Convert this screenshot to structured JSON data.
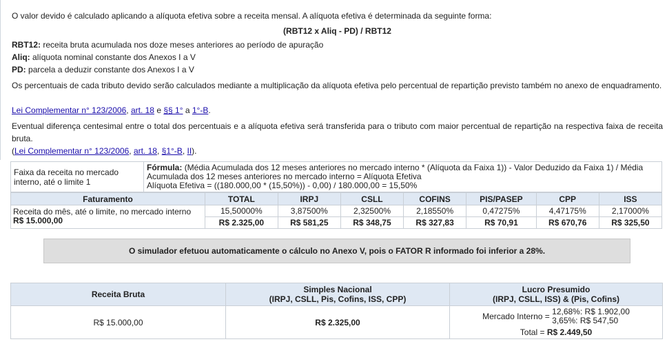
{
  "intro": "O valor devido é calculado aplicando a alíquota efetiva sobre a receita mensal. A alíquota efetiva é determinada da seguinte forma:",
  "formula": "(RBT12 x Aliq - PD) / RBT12",
  "defs": [
    {
      "term": "RBT12:",
      "text": "receita bruta acumulada nos doze meses anteriores ao período de apuração"
    },
    {
      "term": "Aliq:",
      "text": "alíquota nominal constante dos Anexos I a V"
    },
    {
      "term": "PD:",
      "text": "parcela a deduzir constante dos Anexos I a V"
    }
  ],
  "para1": "Os percentuais de cada tributo devido serão calculados mediante a multiplicação da alíquota efetiva pelo percentual de repartição previsto também no anexo de enquadramento.",
  "links1": {
    "law": "Lei Complementar n° 123/2006",
    "sep1": ",",
    "art": "art. 18",
    "sep2": "e",
    "par": "§§ 1°",
    "sep3": "a",
    "par2": "1°-B",
    "end": "."
  },
  "para2": "Eventual diferença centesimal entre o total dos percentuais e a alíquota efetiva será transferida para o tributo com maior percentual de repartição na respectiva faixa de receita bruta.",
  "links2": {
    "open": "(",
    "law": "Lei Complementar n° 123/2006",
    "sep1": ",",
    "art": "art. 18",
    "sep2": ",",
    "par": "§1°-B",
    "sep3": ",",
    "inc": "II",
    "end": ")."
  },
  "faixa": {
    "label": "Faixa da receita no mercado interno, até o limite 1",
    "formula_label": "Fórmula:",
    "formula_text": "(Média Acumulada dos 12 meses anteriores no mercado interno * (Alíquota da Faixa 1)) - Valor Deduzido da Faixa 1) / Média Acumulada dos 12 meses anteriores no mercado interno = Alíquota Efetiva",
    "formula_calc": "Alíquota Efetiva = ((180.000,00 * (15,50%)) - 0,00) / 180.000,00 = 15,50%"
  },
  "tributos": {
    "headers": [
      "Faturamento",
      "TOTAL",
      "IRPJ",
      "CSLL",
      "COFINS",
      "PIS/PASEP",
      "CPP",
      "ISS"
    ],
    "row_label": "Receita do mês, até o limite, no mercado interno",
    "row_value": "R$ 15.000,00",
    "percent": [
      "15,50000%",
      "3,87500%",
      "2,32500%",
      "2,18550%",
      "0,47275%",
      "4,47175%",
      "2,17000%"
    ],
    "values": [
      "R$ 2.325,00",
      "R$ 581,25",
      "R$ 348,75",
      "R$ 327,83",
      "R$ 70,91",
      "R$ 670,76",
      "R$ 325,50"
    ]
  },
  "notice": "O simulador efetuou automaticamente o cálculo no Anexo V, pois o FATOR R informado foi inferior a 28%.",
  "comparativo": {
    "h_receita": "Receita Bruta",
    "h_simples": "Simples Nacional",
    "h_simples_sub": "(IRPJ, CSLL, Pis, Cofins, ISS, CPP)",
    "h_lucro": "Lucro Presumido",
    "h_lucro_sub": "(IRPJ, CSLL, ISS) & (Pis, Cofins)",
    "receita": "R$ 15.000,00",
    "simples": "R$ 2.325,00",
    "mercado_label": "Mercado Interno =",
    "lp_line1": "12,68%: R$ 1.902,00",
    "lp_line2": "3,65%: R$ 547,50",
    "total_label": "Total =",
    "total_value": "R$ 2.449,50"
  }
}
